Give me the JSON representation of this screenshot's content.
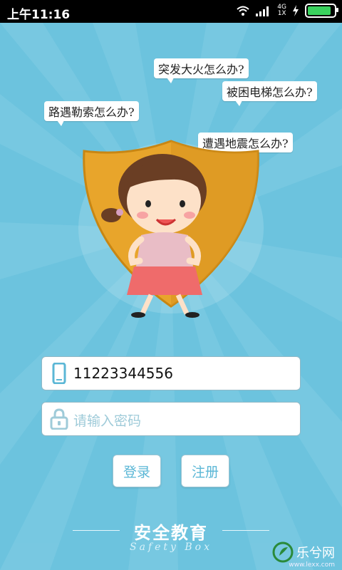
{
  "status_bar": {
    "time": "上午11:16",
    "network_top": "4G",
    "network_bottom": "1X"
  },
  "bubbles": {
    "fire": "突发大火怎么办?",
    "elevator": "被困电梯怎么办?",
    "robbery": "路遇勒索怎么办?",
    "earthquake": "遭遇地震怎么办?"
  },
  "login": {
    "phone_value": "11223344556",
    "password_placeholder": "请输入密码",
    "login_label": "登录",
    "register_label": "注册"
  },
  "footer": {
    "title": "安全教育",
    "subtitle": "Safety Box"
  },
  "watermark": {
    "text": "乐兮网",
    "url": "www.lexx.com"
  },
  "colors": {
    "background": "#6cc3de",
    "accent": "#5bb7d6",
    "shield": "#e8a52b"
  }
}
